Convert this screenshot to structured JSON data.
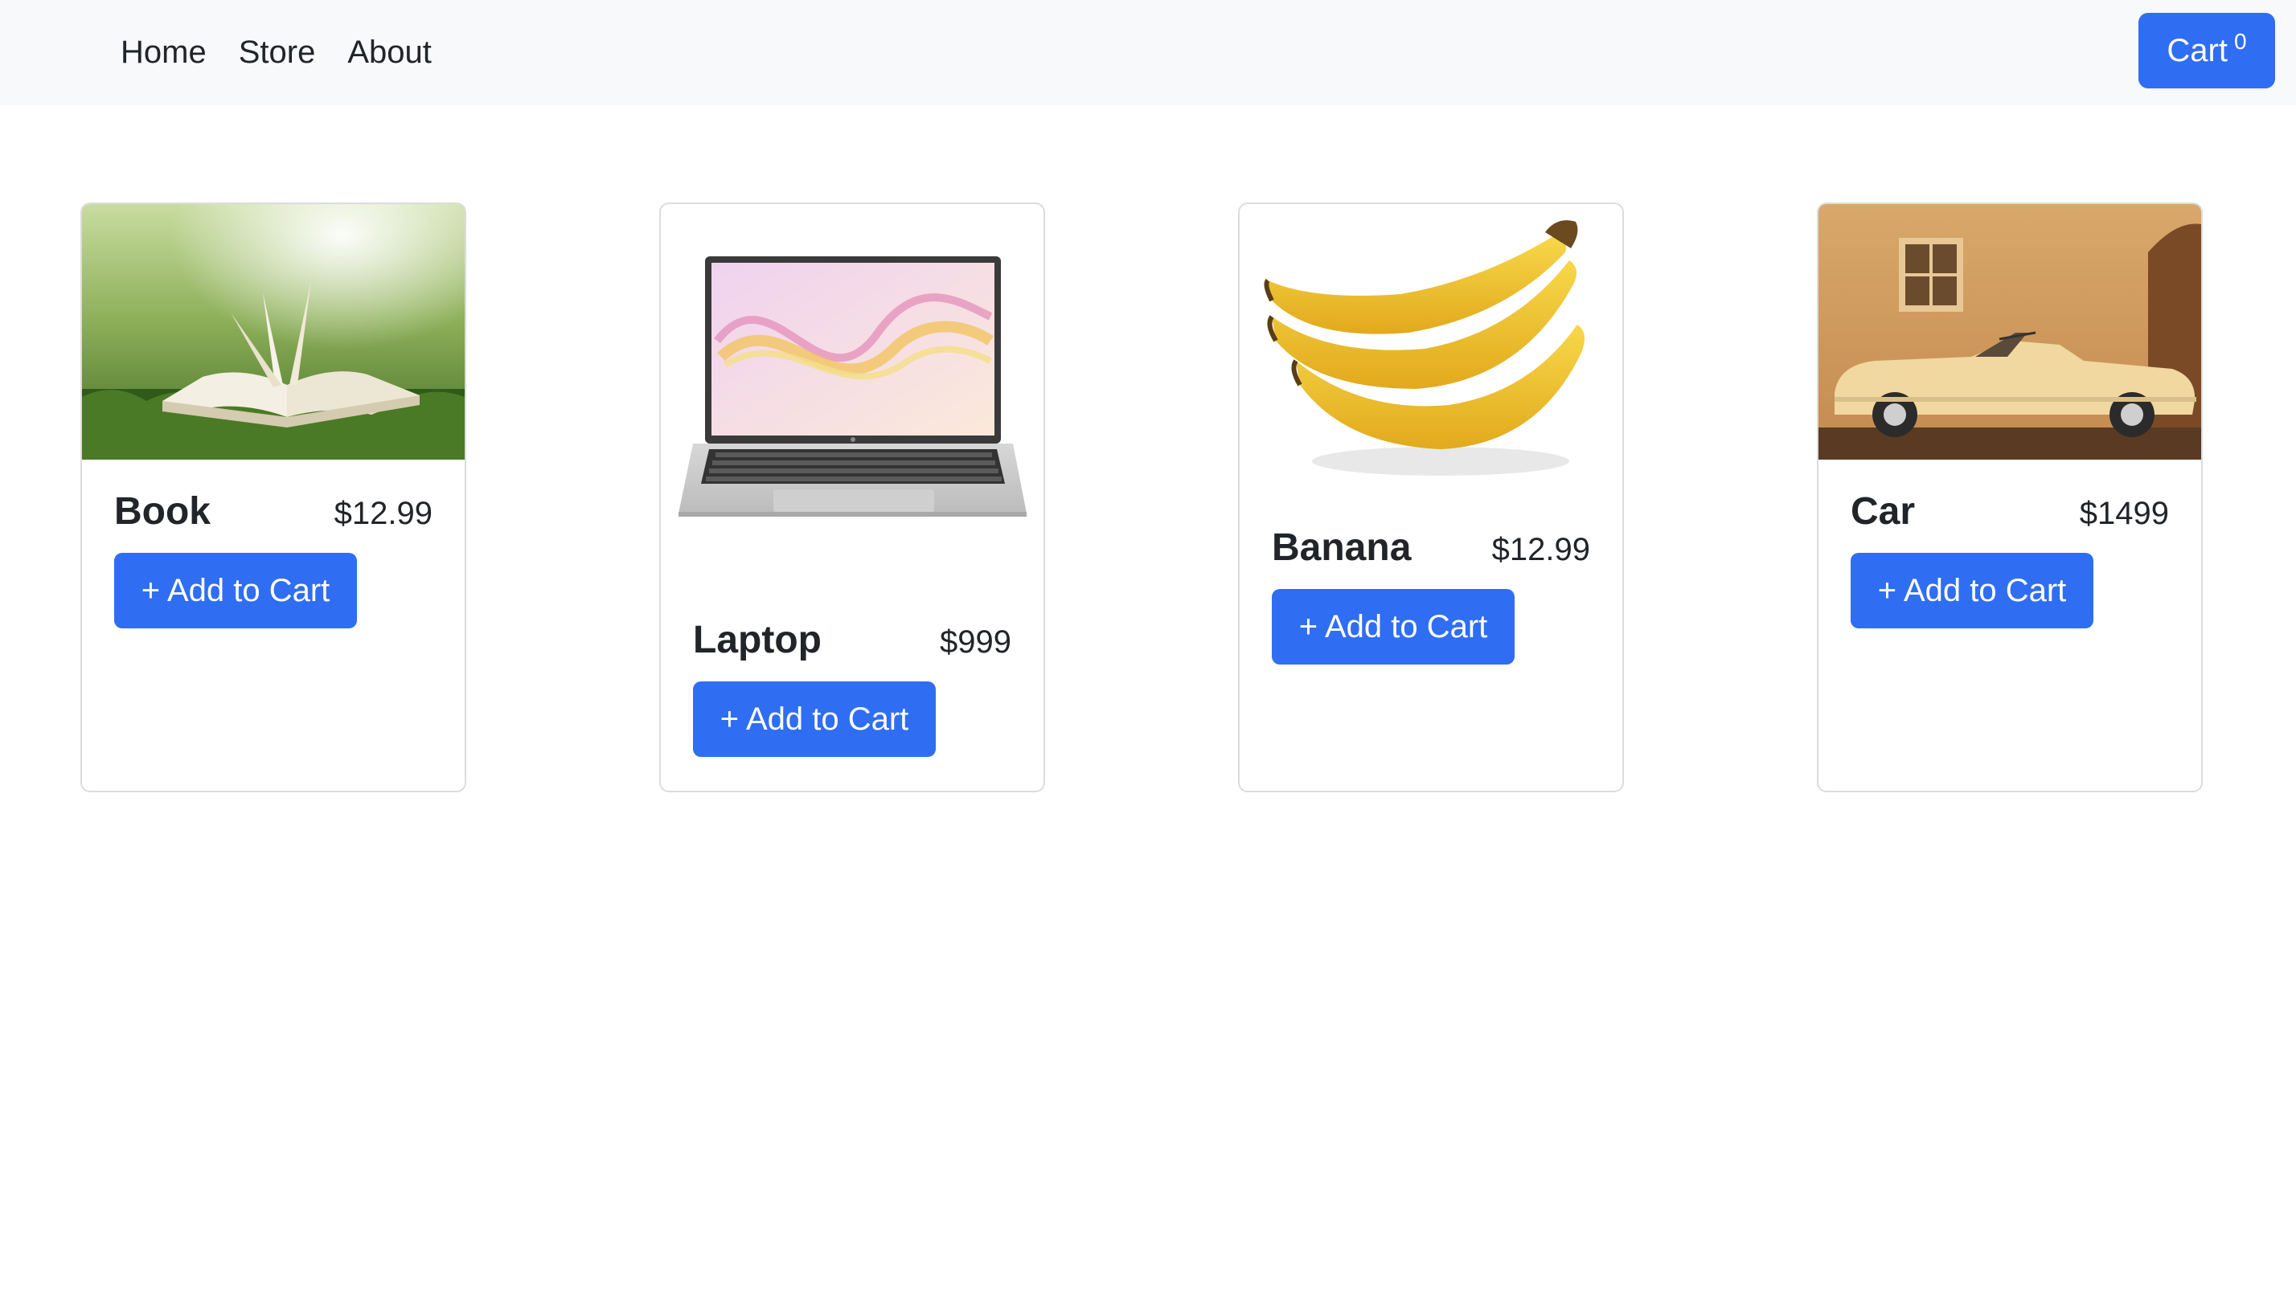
{
  "nav": {
    "links": [
      {
        "label": "Home"
      },
      {
        "label": "Store"
      },
      {
        "label": "About"
      }
    ],
    "cart": {
      "label": "Cart",
      "count": "0"
    }
  },
  "products": [
    {
      "name": "Book",
      "price": "$12.99",
      "button": "+ Add to Cart",
      "image_icon": "book-photo"
    },
    {
      "name": "Laptop",
      "price": "$999",
      "button": "+ Add to Cart",
      "image_icon": "laptop-photo"
    },
    {
      "name": "Banana",
      "price": "$12.99",
      "button": "+ Add to Cart",
      "image_icon": "banana-photo"
    },
    {
      "name": "Car",
      "price": "$1499",
      "button": "+ Add to Cart",
      "image_icon": "car-photo"
    }
  ],
  "colors": {
    "primary": "#2f6ef2",
    "navbar_bg": "#f8f9fa",
    "card_border": "#dcdcdc"
  }
}
